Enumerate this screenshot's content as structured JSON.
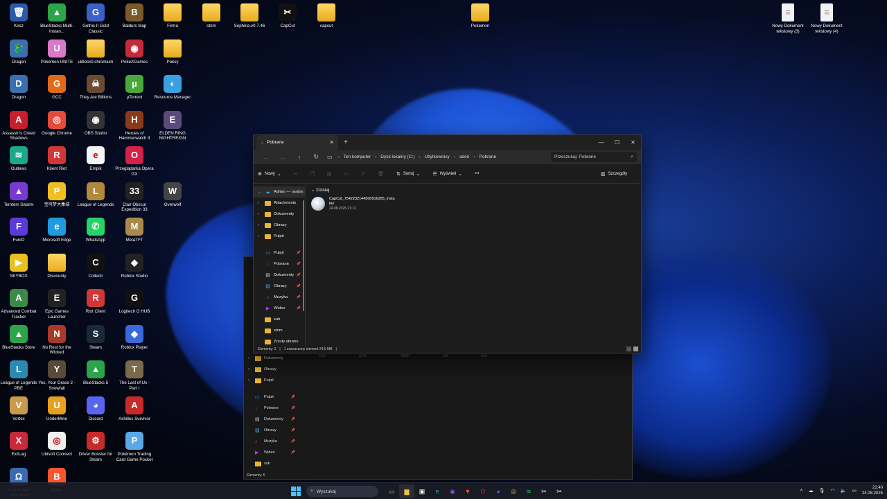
{
  "desktop_icons": [
    {
      "label": "Kosz",
      "icon": "recycle-bin-icon",
      "glyph": "🗑",
      "color": "#2b5aa8"
    },
    {
      "label": "BlueStacks Multi-Instan...",
      "icon": "bluestacks-multi-icon",
      "glyph": "▲",
      "color": "#2ca44a"
    },
    {
      "label": "Gothic II Gold Classic",
      "icon": "gothic-icon",
      "glyph": "G",
      "color": "#3b5fc4"
    },
    {
      "label": "Baldurs Map",
      "icon": "baldurs-map-icon",
      "glyph": "B",
      "color": "#7a5a2a"
    },
    {
      "label": "Firma",
      "icon": "folder-icon",
      "glyph": "",
      "color": "folder"
    },
    {
      "label": "strim",
      "icon": "folder-icon",
      "glyph": "",
      "color": "folder"
    },
    {
      "label": "Sephiria.v0.7.46",
      "icon": "folder-icon",
      "glyph": "",
      "color": "folder"
    },
    {
      "label": "CapCut",
      "icon": "capcut-icon",
      "glyph": "✂",
      "color": "#111111"
    },
    {
      "label": "capcut",
      "icon": "folder-icon",
      "glyph": "",
      "color": "folder"
    },
    {
      "label": "Pokemon",
      "icon": "folder-icon",
      "glyph": "",
      "color": "folder"
    },
    {
      "label": "Nowy Dokument tekstowy (3)",
      "icon": "text-document-icon",
      "glyph": "",
      "color": "doc"
    },
    {
      "label": "Nowy Dokument tekstowy (4)",
      "icon": "text-document-icon",
      "glyph": "",
      "color": "doc"
    },
    {
      "label": "Dragon",
      "icon": "dragon-icon",
      "glyph": "🐉",
      "color": "#3a6fb0"
    },
    {
      "label": "Pokémon UNITE",
      "icon": "pokemon-unite-icon",
      "glyph": "U",
      "color": "#d87ac8"
    },
    {
      "label": "uBlock0.chromium",
      "icon": "folder-icon",
      "glyph": "",
      "color": "folder"
    },
    {
      "label": "PokeXGames",
      "icon": "pokexgames-icon",
      "glyph": "◉",
      "color": "#c42a3a"
    },
    {
      "label": "Poksy",
      "icon": "folder-icon",
      "glyph": "",
      "color": "folder"
    },
    {
      "label": "Dragon",
      "icon": "dragon-icon",
      "glyph": "D",
      "color": "#3a6fb0"
    },
    {
      "label": "GCC",
      "icon": "gcc-icon",
      "glyph": "G",
      "color": "#e06a1c"
    },
    {
      "label": "They Are Billions",
      "icon": "they-are-billions-icon",
      "glyph": "☠",
      "color": "#6a4b32"
    },
    {
      "label": "µTorrent",
      "icon": "utorrent-icon",
      "glyph": "µ",
      "color": "#4aa83a"
    },
    {
      "label": "Resource Manager",
      "icon": "resource-manager-icon",
      "glyph": "◐",
      "color": "#3aa0e0"
    },
    {
      "label": "Assassin's Creed Shadows",
      "icon": "assassins-creed-icon",
      "glyph": "A",
      "color": "#c81e2e"
    },
    {
      "label": "Google Chrome",
      "icon": "chrome-icon",
      "glyph": "◎",
      "color": "#e44b3a"
    },
    {
      "label": "OBS Studio",
      "icon": "obs-icon",
      "glyph": "◉",
      "color": "#333333"
    },
    {
      "label": "Heroes of Hammerwatch II",
      "icon": "heroes-hammerwatch-icon",
      "glyph": "H",
      "color": "#8a3a1a"
    },
    {
      "label": "ELDEN RING NIGHTREIGN",
      "icon": "elden-ring-icon",
      "glyph": "E",
      "color": "#5a4a7a"
    },
    {
      "label": "Outlews",
      "icon": "outlews-icon",
      "glyph": "≋",
      "color": "#1aa888"
    },
    {
      "label": "Klient Riot",
      "icon": "riot-client-icon",
      "glyph": "R",
      "color": "#d13639"
    },
    {
      "label": "Empik",
      "icon": "empik-icon",
      "glyph": "e",
      "color": "#f4f4f4"
    },
    {
      "label": "Przeglądarka Opera GX",
      "icon": "opera-gx-icon",
      "glyph": "O",
      "color": "#d2224a"
    },
    {
      "label": "Temtem Swarm",
      "icon": "temtem-icon",
      "glyph": "▲",
      "color": "#7a3ad0"
    },
    {
      "label": "宝可梦大集结",
      "icon": "pokemon-unite-cn-icon",
      "glyph": "P",
      "color": "#f0c020"
    },
    {
      "label": "League of Legends",
      "icon": "league-icon",
      "glyph": "L",
      "color": "#b08a3a"
    },
    {
      "label": "Clair Obscur Expedition 33",
      "icon": "clair-obscur-icon",
      "glyph": "33",
      "color": "#222222"
    },
    {
      "label": "Overwolf",
      "icon": "overwolf-icon",
      "glyph": "W",
      "color": "#444444"
    },
    {
      "label": "FunID",
      "icon": "funid-icon",
      "glyph": "F",
      "color": "#5a3ad8"
    },
    {
      "label": "Microsoft Edge",
      "icon": "edge-icon",
      "glyph": "e",
      "color": "#1f9ae0"
    },
    {
      "label": "WhatsApp",
      "icon": "whatsapp-icon",
      "glyph": "✆",
      "color": "#25d366"
    },
    {
      "label": "MetaTFT",
      "icon": "metatft-icon",
      "glyph": "M",
      "color": "#a88a4a"
    },
    {
      "label": "SKYBOX",
      "icon": "skybox-icon",
      "glyph": "▶",
      "color": "#e8c020"
    },
    {
      "label": "Discounty",
      "icon": "folder-icon",
      "glyph": "",
      "color": "folder"
    },
    {
      "label": "Collectr",
      "icon": "collectr-icon",
      "glyph": "C",
      "color": "#111111"
    },
    {
      "label": "Roblox Studio",
      "icon": "roblox-studio-icon",
      "glyph": "◆",
      "color": "#222222"
    },
    {
      "label": "Advanced Combat Tracker",
      "icon": "act-icon",
      "glyph": "A",
      "color": "#3a8a4a"
    },
    {
      "label": "Epic Games Launcher",
      "icon": "epic-games-icon",
      "glyph": "E",
      "color": "#222222"
    },
    {
      "label": "Riot Client",
      "icon": "riot-client-icon",
      "glyph": "R",
      "color": "#d13639"
    },
    {
      "label": "Logitech G HUB",
      "icon": "logitech-icon",
      "glyph": "G",
      "color": "#111111"
    },
    {
      "label": "BlueStacks Store",
      "icon": "bluestacks-store-icon",
      "glyph": "▲",
      "color": "#2ca44a"
    },
    {
      "label": "No Rest for the Wicked",
      "icon": "no-rest-icon",
      "glyph": "N",
      "color": "#a83a2a"
    },
    {
      "label": "Steam",
      "icon": "steam-icon",
      "glyph": "S",
      "color": "#1b2838"
    },
    {
      "label": "Roblox Player",
      "icon": "roblox-player-icon",
      "glyph": "◆",
      "color": "#3a6ad8"
    },
    {
      "label": "League of Legends PBE",
      "icon": "league-pbe-icon",
      "glyph": "L",
      "color": "#2a8ab0"
    },
    {
      "label": "Yes, Your Grace 2 - Snowfall",
      "icon": "yes-your-grace-icon",
      "glyph": "Y",
      "color": "#5a4a3a"
    },
    {
      "label": "BlueStacks 5",
      "icon": "bluestacks-icon",
      "glyph": "▲",
      "color": "#2ca44a"
    },
    {
      "label": "The Last of Us - Part I",
      "icon": "last-of-us-icon",
      "glyph": "T",
      "color": "#7a6a4a"
    },
    {
      "label": "Vortex",
      "icon": "vortex-icon",
      "glyph": "V",
      "color": "#c89a4a"
    },
    {
      "label": "UnderMine",
      "icon": "undermine-icon",
      "glyph": "U",
      "color": "#e8a020"
    },
    {
      "label": "Discord",
      "icon": "discord-icon",
      "glyph": "◕",
      "color": "#5865f2"
    },
    {
      "label": "Achilles Survivor",
      "icon": "achilles-icon",
      "glyph": "A",
      "color": "#c82a2a"
    },
    {
      "label": "ExitLag",
      "icon": "exitlag-icon",
      "glyph": "X",
      "color": "#c82a3a"
    },
    {
      "label": "Ubisoft Connect",
      "icon": "ubisoft-icon",
      "glyph": "◎",
      "color": "#f0f0f0"
    },
    {
      "label": "Driver Booster for Steam",
      "icon": "driver-booster-icon",
      "glyph": "⚙",
      "color": "#c82a2a"
    },
    {
      "label": "Pokémon Trading Card Game Pocket",
      "icon": "pokemon-tcg-icon",
      "glyph": "P",
      "color": "#5aa8e8"
    },
    {
      "label": "God of War Ragnarok",
      "icon": "god-of-war-icon",
      "glyph": "Ω",
      "color": "#3a6ab0"
    },
    {
      "label": "Brave",
      "icon": "brave-icon",
      "glyph": "B",
      "color": "#fb542b"
    }
  ],
  "explorer": {
    "tab_title": "Pobrane",
    "breadcrumbs": [
      "Ten komputer",
      "Dysk lokalny (C:)",
      "Użytkownicy",
      "aderi",
      "Pobrane"
    ],
    "search_placeholder": "Przeszukaj: Pobrane",
    "toolbar": {
      "new": "Nowy",
      "sort": "Sortuj",
      "view": "Wyświetl",
      "more": "•••",
      "details": "Szczegóły"
    },
    "sidebar": [
      {
        "label": "Adrian — osobis",
        "kind": "root"
      },
      {
        "label": "Attachments",
        "kind": "folder"
      },
      {
        "label": "Dokumenty",
        "kind": "folder"
      },
      {
        "label": "Obrazy",
        "kind": "folder"
      },
      {
        "label": "Pulpit",
        "kind": "folder"
      }
    ],
    "quick_access": [
      {
        "label": "Pulpit",
        "icon": "desktop-icon",
        "glyph": "▭",
        "color": "#4aa0e0"
      },
      {
        "label": "Pobrane",
        "icon": "download-icon",
        "glyph": "↓",
        "color": "#3dba6c"
      },
      {
        "label": "Dokumenty",
        "icon": "documents-icon",
        "glyph": "▤",
        "color": "#cccccc"
      },
      {
        "label": "Obrazy",
        "icon": "pictures-icon",
        "glyph": "▨",
        "color": "#4aa0e0"
      },
      {
        "label": "Muzyka",
        "icon": "music-icon",
        "glyph": "♪",
        "color": "#e06a6a"
      },
      {
        "label": "Wideo",
        "icon": "video-icon",
        "glyph": "▶",
        "color": "#a04ae0"
      },
      {
        "label": "sub",
        "icon": "folder-icon",
        "glyph": "",
        "color": "folder"
      },
      {
        "label": "strim",
        "icon": "folder-icon",
        "glyph": "",
        "color": "folder"
      },
      {
        "label": "Zrzuty ekranu",
        "icon": "folder-icon",
        "glyph": "",
        "color": "folder"
      }
    ],
    "group_header": "Dzisiaj",
    "file": {
      "name": "CapCut_7542232144500916285_installer",
      "date": "24.08.2025 21:12"
    },
    "status": {
      "count": "Elementy: 2",
      "selection": "1 zaznaczony element  24,5 MB"
    }
  },
  "back_window": {
    "columns": [
      "4ZG",
      "374C",
      "RBSP",
      "3I3",
      "A14"
    ],
    "sidebar": [
      {
        "label": "Dokumenty",
        "kind": "folder"
      },
      {
        "label": "Obrazy",
        "kind": "folder"
      },
      {
        "label": "Pulpit",
        "kind": "folder"
      }
    ],
    "quick_access": [
      {
        "label": "Pulpit",
        "glyph": "▭",
        "color": "#4aa0e0"
      },
      {
        "label": "Pobrane",
        "glyph": "↓",
        "color": "#3dba6c"
      },
      {
        "label": "Dokumenty",
        "glyph": "▤",
        "color": "#cccccc"
      },
      {
        "label": "Obrazy",
        "glyph": "▨",
        "color": "#4aa0e0"
      },
      {
        "label": "Muzyka",
        "glyph": "♪",
        "color": "#e06a6a"
      },
      {
        "label": "Wideo",
        "glyph": "▶",
        "color": "#a04ae0"
      },
      {
        "label": "sub",
        "glyph": "",
        "color": "folder"
      }
    ],
    "status": "Elementy: 6"
  },
  "taskbar": {
    "search_placeholder": "Wyszukaj",
    "apps": [
      {
        "icon": "task-view-icon",
        "glyph": "▭",
        "color": "#cccccc"
      },
      {
        "icon": "file-explorer-icon",
        "glyph": "▆",
        "color": "#f0c040",
        "active": true
      },
      {
        "icon": "store-icon",
        "glyph": "▣",
        "color": "#ffffff"
      },
      {
        "icon": "edge-icon",
        "glyph": "e",
        "color": "#1f9ae0"
      },
      {
        "icon": "outlook-icon",
        "glyph": "◉",
        "color": "#7a5ad8"
      },
      {
        "icon": "brave-icon",
        "glyph": "▼",
        "color": "#fb542b"
      },
      {
        "icon": "opera-gx-icon",
        "glyph": "O",
        "color": "#d2224a"
      },
      {
        "icon": "discord-icon",
        "glyph": "◕",
        "color": "#5865f2"
      },
      {
        "icon": "chrome-icon",
        "glyph": "◎",
        "color": "#e8c030"
      },
      {
        "icon": "spotify-icon",
        "glyph": "≋",
        "color": "#1db954"
      },
      {
        "icon": "capcut-icon",
        "glyph": "✂",
        "color": "#ffffff"
      },
      {
        "icon": "capcut-installer-icon",
        "glyph": "✂",
        "color": "#ffffff"
      }
    ],
    "tray_icons": [
      "chevron-up-icon",
      "onedrive-icon",
      "wifi-icon",
      "volume-icon",
      "battery-icon",
      "language-icon"
    ],
    "time": "21:40",
    "date": "24.08.2025"
  },
  "colors": {
    "accent": "#4cc2ff",
    "window_bg": "#1c1c1c",
    "folder": "#e9b634"
  }
}
